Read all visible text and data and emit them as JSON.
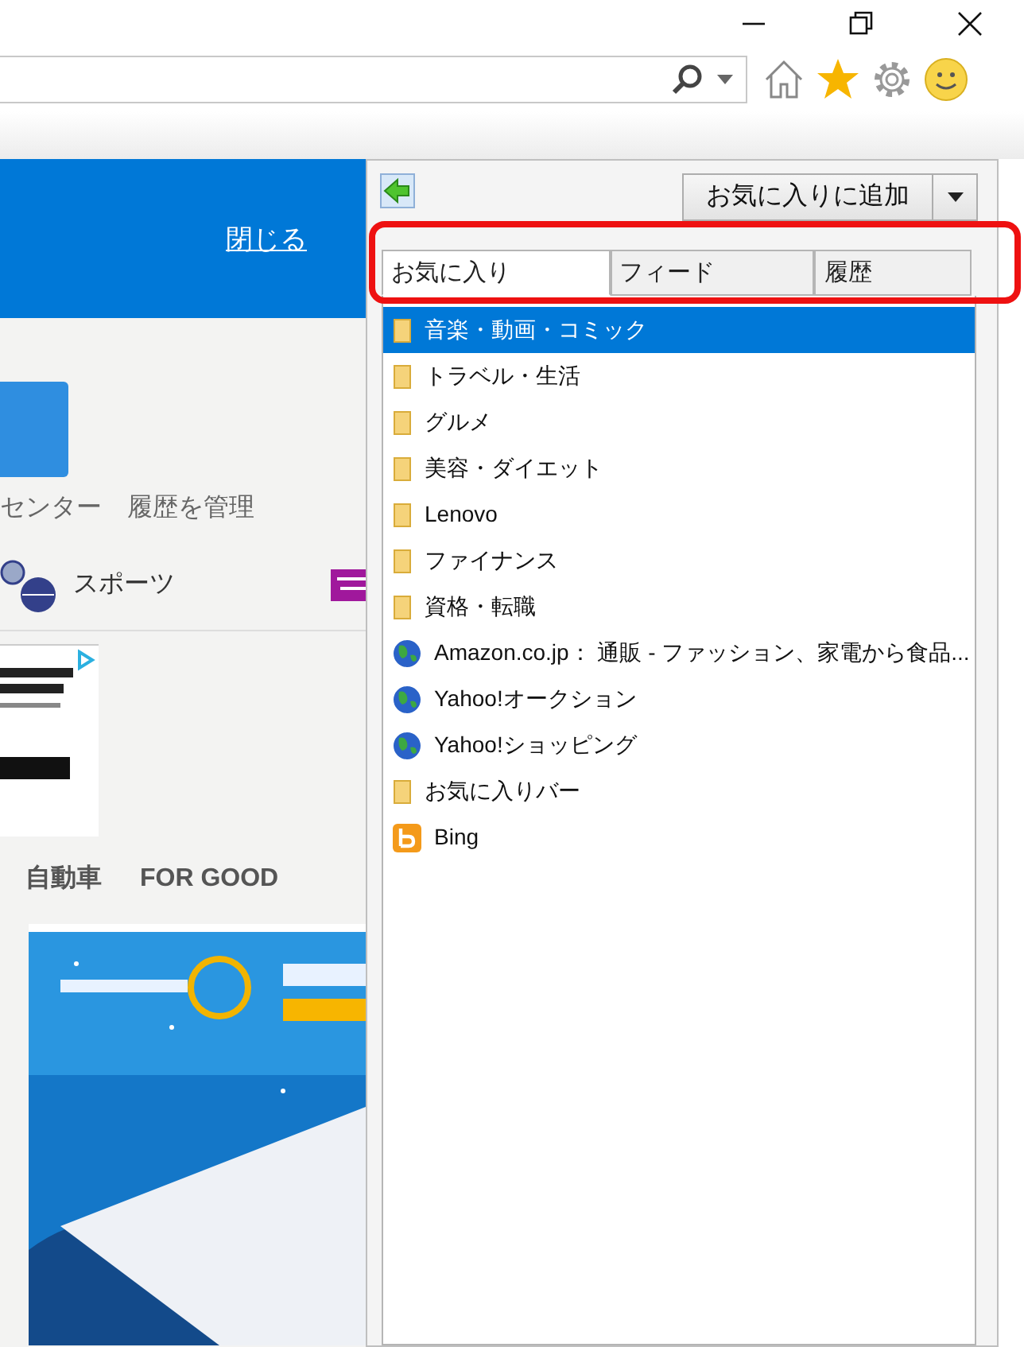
{
  "page": {
    "close_link": "閉じる",
    "links": [
      "センター",
      "履歴を管理"
    ],
    "category": "スポーツ",
    "nav": [
      "自動車",
      "FOR GOOD"
    ]
  },
  "favorites_panel": {
    "add_button": "お気に入りに追加",
    "tabs": [
      {
        "label": "お気に入り",
        "selected": true
      },
      {
        "label": "フィード",
        "selected": false
      },
      {
        "label": "履歴",
        "selected": false
      }
    ],
    "items": [
      {
        "kind": "folder",
        "label": "音楽・動画・コミック",
        "selected": true
      },
      {
        "kind": "folder",
        "label": "トラベル・生活",
        "selected": false
      },
      {
        "kind": "folder",
        "label": "グルメ",
        "selected": false
      },
      {
        "kind": "folder",
        "label": "美容・ダイエット",
        "selected": false
      },
      {
        "kind": "folder",
        "label": "Lenovo",
        "selected": false
      },
      {
        "kind": "folder",
        "label": "ファイナンス",
        "selected": false
      },
      {
        "kind": "folder",
        "label": "資格・転職",
        "selected": false
      },
      {
        "kind": "site",
        "label": "Amazon.co.jp： 通販 - ファッション、家電から食品...",
        "selected": false
      },
      {
        "kind": "site",
        "label": "Yahoo!オークション",
        "selected": false
      },
      {
        "kind": "site",
        "label": "Yahoo!ショッピング",
        "selected": false
      },
      {
        "kind": "folder",
        "label": "お気に入りバー",
        "selected": false
      },
      {
        "kind": "bing",
        "label": "Bing",
        "selected": false
      }
    ]
  }
}
